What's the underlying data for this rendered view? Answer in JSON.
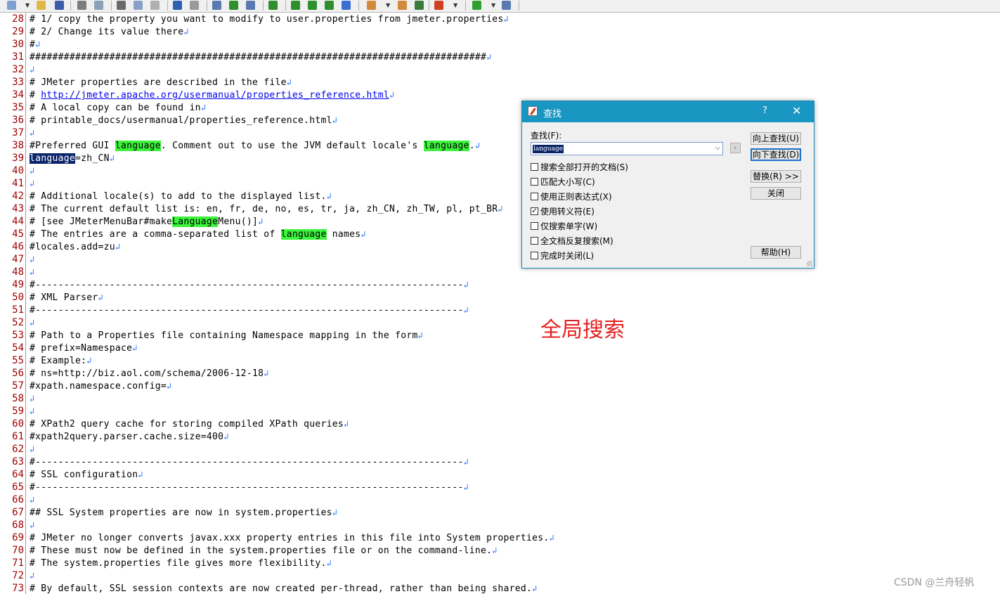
{
  "toolbar": {
    "icons": [
      "new-file-icon",
      "open-folder-icon",
      "save-icon",
      "print-icon",
      "print-preview-icon",
      "cut-icon",
      "copy-icon",
      "paste-icon",
      "undo-icon",
      "redo-icon",
      "find-icon",
      "find-next-icon",
      "replace-icon",
      "column-mode-icon",
      "word-wrap-icon",
      "show-all-chars-icon",
      "indent-guide-icon",
      "browser-icon",
      "spellcheck-icon",
      "compare-icon",
      "chart-icon",
      "record-macro-icon",
      "play-macro-icon",
      "pin-icon"
    ]
  },
  "editor": {
    "lines": [
      {
        "n": "28",
        "segments": [
          {
            "t": "# 1/ copy the property you want to modify to user.properties from jmeter.properties"
          }
        ]
      },
      {
        "n": "29",
        "segments": [
          {
            "t": "# 2/ Change its value there"
          }
        ]
      },
      {
        "n": "30",
        "segments": [
          {
            "t": "#"
          }
        ]
      },
      {
        "n": "31",
        "segments": [
          {
            "t": "################################################################################"
          }
        ]
      },
      {
        "n": "32",
        "segments": []
      },
      {
        "n": "33",
        "segments": [
          {
            "t": "# JMeter properties are described in the file"
          }
        ]
      },
      {
        "n": "34",
        "segments": [
          {
            "t": "# "
          },
          {
            "t": "http://jmeter.apache.org/usermanual/properties_reference.html",
            "s": "link"
          }
        ]
      },
      {
        "n": "35",
        "segments": [
          {
            "t": "# A local copy can be found in"
          }
        ]
      },
      {
        "n": "36",
        "segments": [
          {
            "t": "# printable_docs/usermanual/properties_reference.html"
          }
        ]
      },
      {
        "n": "37",
        "segments": []
      },
      {
        "n": "38",
        "segments": [
          {
            "t": "#Preferred GUI "
          },
          {
            "t": "language",
            "s": "hl"
          },
          {
            "t": ". Comment out to use the JVM default locale's "
          },
          {
            "t": "language",
            "s": "hl"
          },
          {
            "t": "."
          }
        ]
      },
      {
        "n": "39",
        "segments": [
          {
            "t": "language",
            "s": "sel"
          },
          {
            "t": "=zh_CN"
          }
        ]
      },
      {
        "n": "40",
        "segments": []
      },
      {
        "n": "41",
        "segments": []
      },
      {
        "n": "42",
        "segments": [
          {
            "t": "# Additional locale(s) to add to the displayed list."
          }
        ]
      },
      {
        "n": "43",
        "segments": [
          {
            "t": "# The current default list is: en, fr, de, no, es, tr, ja, zh_CN, zh_TW, pl, pt_BR"
          }
        ]
      },
      {
        "n": "44",
        "segments": [
          {
            "t": "# [see JMeterMenuBar#make"
          },
          {
            "t": "Language",
            "s": "hl"
          },
          {
            "t": "Menu()]"
          }
        ]
      },
      {
        "n": "45",
        "segments": [
          {
            "t": "# The entries are a comma-separated list of "
          },
          {
            "t": "language",
            "s": "hl"
          },
          {
            "t": " names"
          }
        ]
      },
      {
        "n": "46",
        "segments": [
          {
            "t": "#locales.add=zu"
          }
        ]
      },
      {
        "n": "47",
        "segments": []
      },
      {
        "n": "48",
        "segments": []
      },
      {
        "n": "49",
        "segments": [
          {
            "t": "#---------------------------------------------------------------------------"
          }
        ]
      },
      {
        "n": "50",
        "segments": [
          {
            "t": "# XML Parser"
          }
        ]
      },
      {
        "n": "51",
        "segments": [
          {
            "t": "#---------------------------------------------------------------------------"
          }
        ]
      },
      {
        "n": "52",
        "segments": []
      },
      {
        "n": "53",
        "segments": [
          {
            "t": "# Path to a Properties file containing Namespace mapping in the form"
          }
        ]
      },
      {
        "n": "54",
        "segments": [
          {
            "t": "# prefix=Namespace"
          }
        ]
      },
      {
        "n": "55",
        "segments": [
          {
            "t": "# Example:"
          }
        ]
      },
      {
        "n": "56",
        "segments": [
          {
            "t": "# ns=http://biz.aol.com/schema/2006-12-18"
          }
        ]
      },
      {
        "n": "57",
        "segments": [
          {
            "t": "#xpath.namespace.config="
          }
        ]
      },
      {
        "n": "58",
        "segments": []
      },
      {
        "n": "59",
        "segments": []
      },
      {
        "n": "60",
        "segments": [
          {
            "t": "# XPath2 query cache for storing compiled XPath queries"
          }
        ]
      },
      {
        "n": "61",
        "segments": [
          {
            "t": "#xpath2query.parser.cache.size=400"
          }
        ]
      },
      {
        "n": "62",
        "segments": []
      },
      {
        "n": "63",
        "segments": [
          {
            "t": "#---------------------------------------------------------------------------"
          }
        ]
      },
      {
        "n": "64",
        "segments": [
          {
            "t": "# SSL configuration"
          }
        ]
      },
      {
        "n": "65",
        "segments": [
          {
            "t": "#---------------------------------------------------------------------------"
          }
        ]
      },
      {
        "n": "66",
        "segments": []
      },
      {
        "n": "67",
        "segments": [
          {
            "t": "## SSL System properties are now in system.properties"
          }
        ]
      },
      {
        "n": "68",
        "segments": []
      },
      {
        "n": "69",
        "segments": [
          {
            "t": "# JMeter no longer converts javax.xxx property entries in this file into System properties."
          }
        ]
      },
      {
        "n": "70",
        "segments": [
          {
            "t": "# These must now be defined in the system.properties file or on the command-line."
          }
        ]
      },
      {
        "n": "71",
        "segments": [
          {
            "t": "# The system.properties file gives more flexibility."
          }
        ]
      },
      {
        "n": "72",
        "segments": []
      },
      {
        "n": "73",
        "segments": [
          {
            "t": "# By default, SSL session contexts are now created per-thread, rather than being shared."
          }
        ]
      }
    ],
    "eol_glyph": "↲"
  },
  "find_dialog": {
    "title": "查找",
    "help": "?",
    "close": "✕",
    "find_label": "查找(F):",
    "find_value": "language",
    "options": [
      {
        "label": "搜索全部打开的文档(S)",
        "checked": false
      },
      {
        "label": "匹配大小写(C)",
        "checked": false
      },
      {
        "label": "使用正则表达式(X)",
        "checked": false
      },
      {
        "label": "使用转义符(E)",
        "checked": true
      },
      {
        "label": "仅搜索单字(W)",
        "checked": false
      },
      {
        "label": "全文档反复搜索(M)",
        "checked": false
      },
      {
        "label": "完成时关闭(L)",
        "checked": false
      }
    ],
    "buttons": {
      "find_up": "向上查找(U)",
      "find_down": "向下查找(D)",
      "replace": "替换(R) >>",
      "close": "关闭",
      "help": "帮助(H)"
    }
  },
  "annotation": "全局搜索",
  "watermark": "CSDN @兰舟轻帆",
  "colors": {
    "highlight": "#3cf43c",
    "selection": "#0a246a",
    "line_number": "#a00000",
    "dialog_title": "#1996c1",
    "annotation": "#e62020"
  }
}
